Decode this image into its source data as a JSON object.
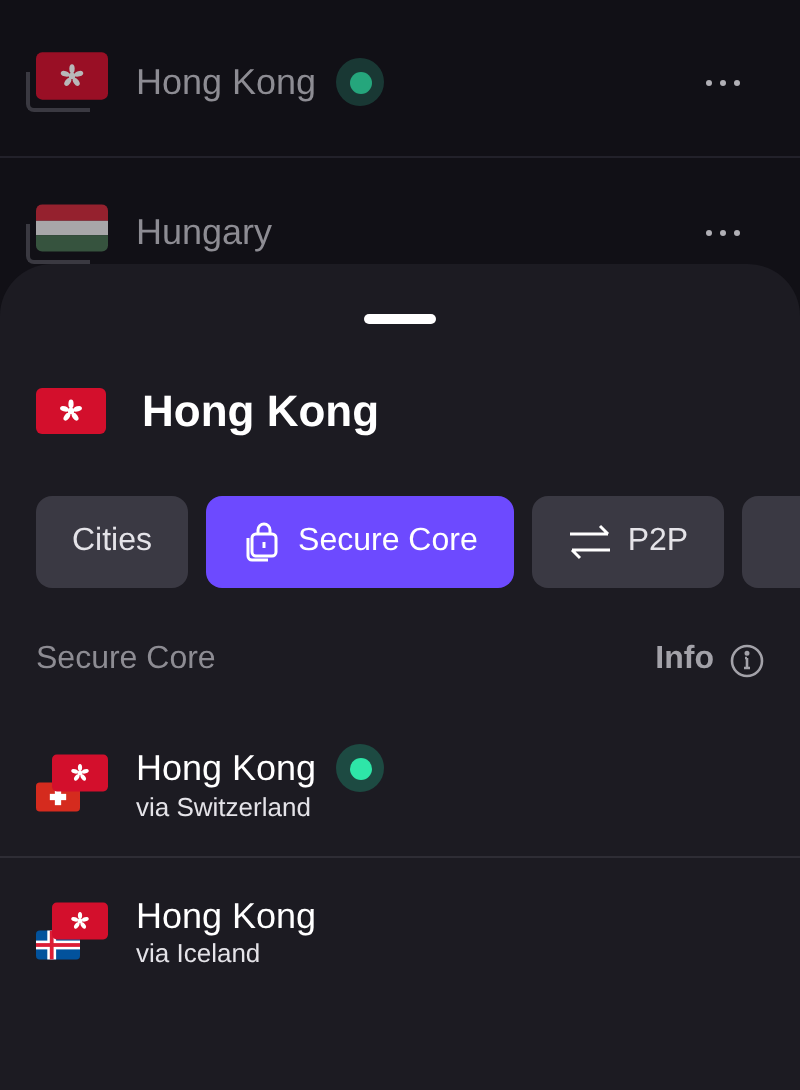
{
  "country_list": [
    {
      "name": "Hong Kong",
      "flag": {
        "kind": "hk"
      },
      "connected": true
    },
    {
      "name": "Hungary",
      "flag": {
        "kind": "hu"
      },
      "connected": false
    }
  ],
  "sheet": {
    "title": "Hong Kong",
    "flag": {
      "kind": "hk"
    },
    "tabs": [
      {
        "label": "Cities",
        "kind": "plain",
        "selected": false
      },
      {
        "label": "Secure Core",
        "kind": "lock",
        "selected": true
      },
      {
        "label": "P2P",
        "kind": "arrows",
        "selected": false
      }
    ],
    "section": {
      "title": "Secure Core",
      "info": "Info"
    },
    "servers": [
      {
        "name": "Hong Kong",
        "via": "via Switzerland",
        "flags": [
          {
            "kind": "hk"
          },
          {
            "kind": "ch"
          }
        ],
        "connected": true
      },
      {
        "name": "Hong Kong",
        "via": "via Iceland",
        "flags": [
          {
            "kind": "hk"
          },
          {
            "kind": "is"
          }
        ],
        "connected": false
      }
    ]
  }
}
